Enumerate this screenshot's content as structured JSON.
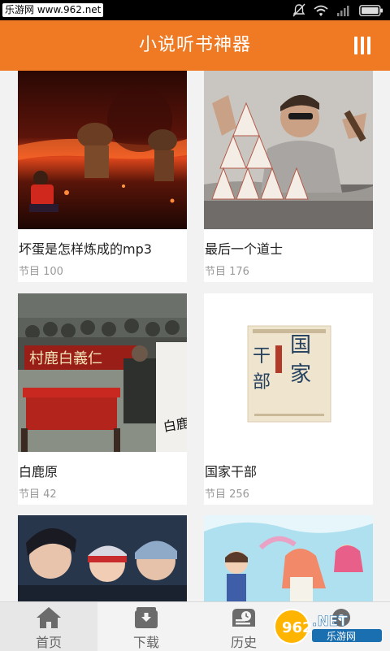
{
  "statusbar": {
    "site": "乐游网 www.962.net"
  },
  "appbar": {
    "title": "小说听书神器"
  },
  "books": [
    {
      "title": "坏蛋是怎样炼成的mp3",
      "episodes": "节目 100"
    },
    {
      "title": "最后一个道士",
      "episodes": "节目 176"
    },
    {
      "title": "白鹿原",
      "episodes": "节目 42"
    },
    {
      "title": "国家干部",
      "episodes": "节目 256"
    },
    {
      "title": "",
      "episodes": ""
    },
    {
      "title": "",
      "episodes": ""
    }
  ],
  "covers": {
    "gjgb": {
      "chars": [
        "国",
        "家",
        "干",
        "部"
      ]
    },
    "blym": {
      "banner": "村鹿白義仁",
      "mark": "白鹿原"
    }
  },
  "tabs": [
    {
      "label": "首页",
      "icon": "home-icon"
    },
    {
      "label": "下载",
      "icon": "download-box-icon"
    },
    {
      "label": "历史",
      "icon": "history-icon"
    },
    {
      "label": "",
      "icon": "settings-icon"
    }
  ],
  "watermark": {
    "brand": "962",
    "domain": ".NET",
    "sub": "乐游网"
  },
  "colors": {
    "accent": "#ef7a23",
    "text": "#222222",
    "meta": "#999999"
  }
}
